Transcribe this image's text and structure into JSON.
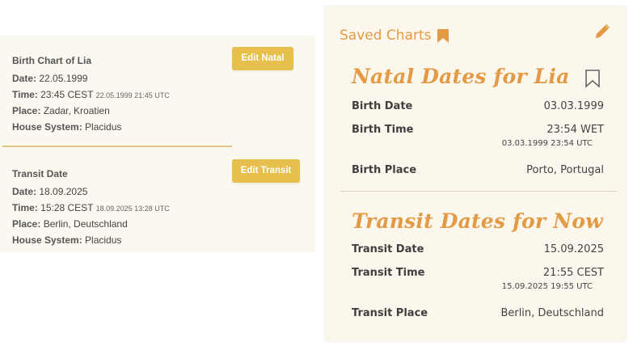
{
  "natal_card": {
    "title": "Birth Chart of Lia",
    "date_label": "Date:",
    "date_value": "22.05.1999",
    "time_label": "Time:",
    "time_value": "23:45 CEST",
    "time_utc": "22.05.1999 21:45 UTC",
    "place_label": "Place:",
    "place_value": "Zadar, Kroatien",
    "house_label": "House System:",
    "house_value": "Placidus",
    "button": "Edit Natal"
  },
  "transit_card": {
    "title": "Transit Date",
    "date_label": "Date:",
    "date_value": "18.09.2025",
    "time_label": "Time:",
    "time_value": "15:28 CEST",
    "time_utc": "18.09.2025 13:28 UTC",
    "place_label": "Place:",
    "place_value": "Berlin, Deutschland",
    "house_label": "House System:",
    "house_value": "Placidus",
    "button": "Edit Transit"
  },
  "saved_panel": {
    "header": "Saved Charts",
    "accent_color": "#e39a45",
    "natal": {
      "title": "Natal Dates for Lia",
      "birth_date_label": "Birth Date",
      "birth_date_value": "03.03.1999",
      "birth_time_label": "Birth Time",
      "birth_time_value": "23:54 WET",
      "birth_time_utc": "03.03.1999 23:54 UTC",
      "birth_place_label": "Birth Place",
      "birth_place_value": "Porto, Portugal"
    },
    "transit": {
      "title": "Transit Dates for Now",
      "transit_date_label": "Transit Date",
      "transit_date_value": "15.09.2025",
      "transit_time_label": "Transit Time",
      "transit_time_value": "21:55 CEST",
      "transit_time_utc": "15.09.2025 19:55 UTC",
      "transit_place_label": "Transit Place",
      "transit_place_value": "Berlin, Deutschland"
    },
    "icons": [
      "bookmark-icon",
      "pencil-icon",
      "bookmark-outline-icon"
    ]
  }
}
